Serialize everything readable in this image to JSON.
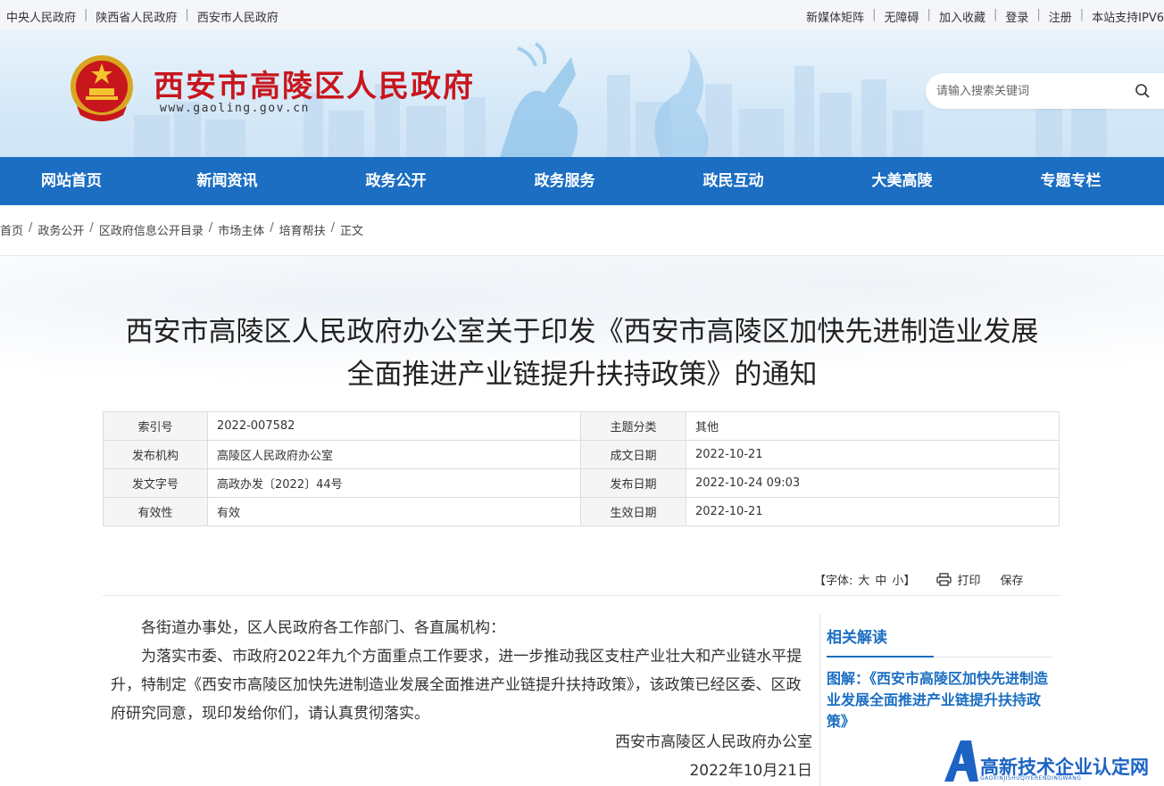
{
  "topbar": {
    "left_links": [
      "中央人民政府",
      "陕西省人民政府",
      "西安市人民政府"
    ],
    "right_links": [
      "新媒体矩阵",
      "无障碍",
      "加入收藏",
      "登录",
      "注册",
      "本站支持IPV6"
    ],
    "separator": "|"
  },
  "header": {
    "title": "西安市高陵区人民政府",
    "url": "www.gaoling.gov.cn",
    "search_placeholder": "请输入搜索关键词"
  },
  "nav": [
    "网站首页",
    "新闻资讯",
    "政务公开",
    "政务服务",
    "政民互动",
    "大美高陵",
    "专题专栏"
  ],
  "breadcrumb": {
    "items": [
      "首页",
      "政务公开",
      "区政府信息公开目录",
      "市场主体",
      "培育帮扶",
      "正文"
    ],
    "separator": "/"
  },
  "document": {
    "title_line1": "西安市高陵区人民政府办公室关于印发《西安市高陵区加快先进制造业发展",
    "title_line2": "全面推进产业链提升扶持政策》的通知",
    "meta": [
      {
        "k1": "索引号",
        "v1": "2022-007582",
        "k2": "主题分类",
        "v2": "其他"
      },
      {
        "k1": "发布机构",
        "v1": "高陵区人民政府办公室",
        "k2": "成文日期",
        "v2": "2022-10-21"
      },
      {
        "k1": "发文字号",
        "v1": "高政办发〔2022〕44号",
        "k2": "发布日期",
        "v2": "2022-10-24 09:03"
      },
      {
        "k1": "有效性",
        "v1": "有效",
        "k2": "生效日期",
        "v2": "2022-10-21"
      }
    ],
    "tools": {
      "font_prefix": "【字体:",
      "font_large": "大",
      "font_medium": "中",
      "font_small": "小",
      "font_suffix": "】",
      "print": "打印",
      "save": "保存"
    },
    "salutation": "各街道办事处，区人民政府各工作部门、各直属机构：",
    "body": "为落实市委、市政府2022年九个方面重点工作要求，进一步推动我区支柱产业壮大和产业链水平提升，特制定《西安市高陵区加快先进制造业发展全面推进产业链提升扶持政策》，该政策已经区委、区政府研究同意，现印发给你们，请认真贯彻落实。",
    "signature": "西安市高陵区人民政府办公室",
    "date": "2022年10月21日"
  },
  "sidebar": {
    "heading": "相关解读",
    "link": "图解：《西安市高陵区加快先进制造业发展全面推进产业链提升扶持政策》"
  },
  "watermark": {
    "text": "高新技术企业认定网",
    "subtext": "GAOXINJISHUQIYERENDINGWANG"
  },
  "colors": {
    "nav_blue": "#1b6ec2",
    "title_red": "#c8161d",
    "link_blue": "#1b6ec2"
  }
}
